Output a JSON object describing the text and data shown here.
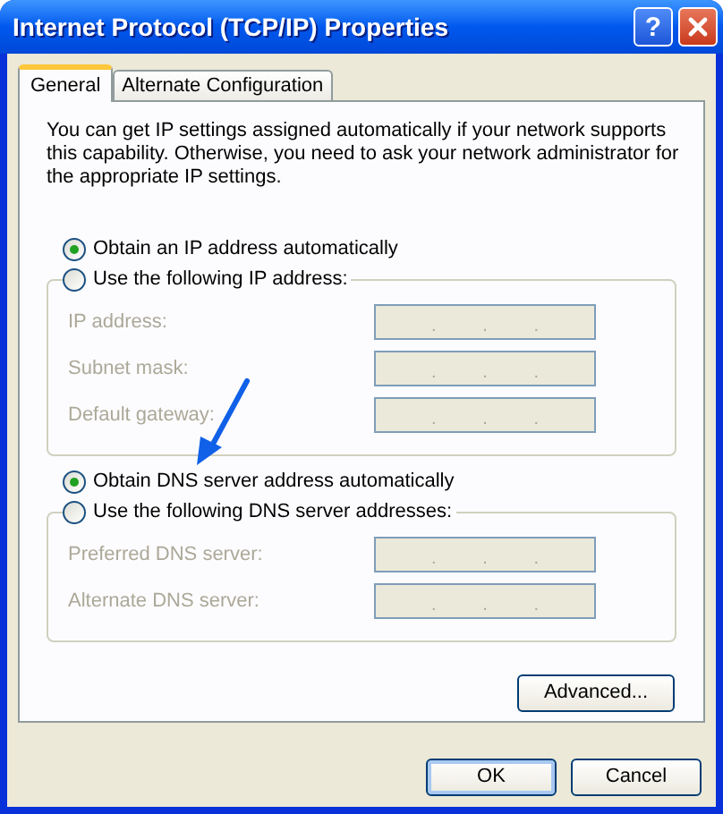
{
  "window": {
    "title": "Internet Protocol (TCP/IP) Properties",
    "help_button": "?"
  },
  "tabs": [
    {
      "label": "General",
      "selected": true
    },
    {
      "label": "Alternate Configuration",
      "selected": false
    }
  ],
  "intro_lines": [
    "You can get IP settings assigned automatically if your network supports",
    "this capability. Otherwise, you need to ask your network administrator for",
    "the appropriate IP settings."
  ],
  "sections": [
    {
      "auto_option": {
        "label": "Obtain an IP address automatically",
        "selected": true
      },
      "manual_option": {
        "label": "Use the following IP address:",
        "selected": false
      },
      "fields": [
        {
          "label": "IP address:",
          "disabled": true,
          "separators": [
            ".",
            ".",
            "."
          ]
        },
        {
          "label": "Subnet mask:",
          "disabled": true,
          "separators": [
            ".",
            ".",
            "."
          ]
        },
        {
          "label": "Default gateway:",
          "disabled": true,
          "separators": [
            ".",
            ".",
            "."
          ]
        }
      ]
    },
    {
      "auto_option": {
        "label": "Obtain DNS server address automatically",
        "selected": true
      },
      "manual_option": {
        "label": "Use the following DNS server addresses:",
        "selected": false
      },
      "fields": [
        {
          "label": "Preferred DNS server:",
          "disabled": true,
          "separators": [
            ".",
            ".",
            "."
          ]
        },
        {
          "label": "Alternate DNS server:",
          "disabled": true,
          "separators": [
            ".",
            ".",
            "."
          ]
        }
      ]
    }
  ],
  "advanced_button": "Advanced...",
  "buttons": [
    {
      "label": "OK",
      "default": true
    },
    {
      "label": "Cancel",
      "default": false
    }
  ]
}
